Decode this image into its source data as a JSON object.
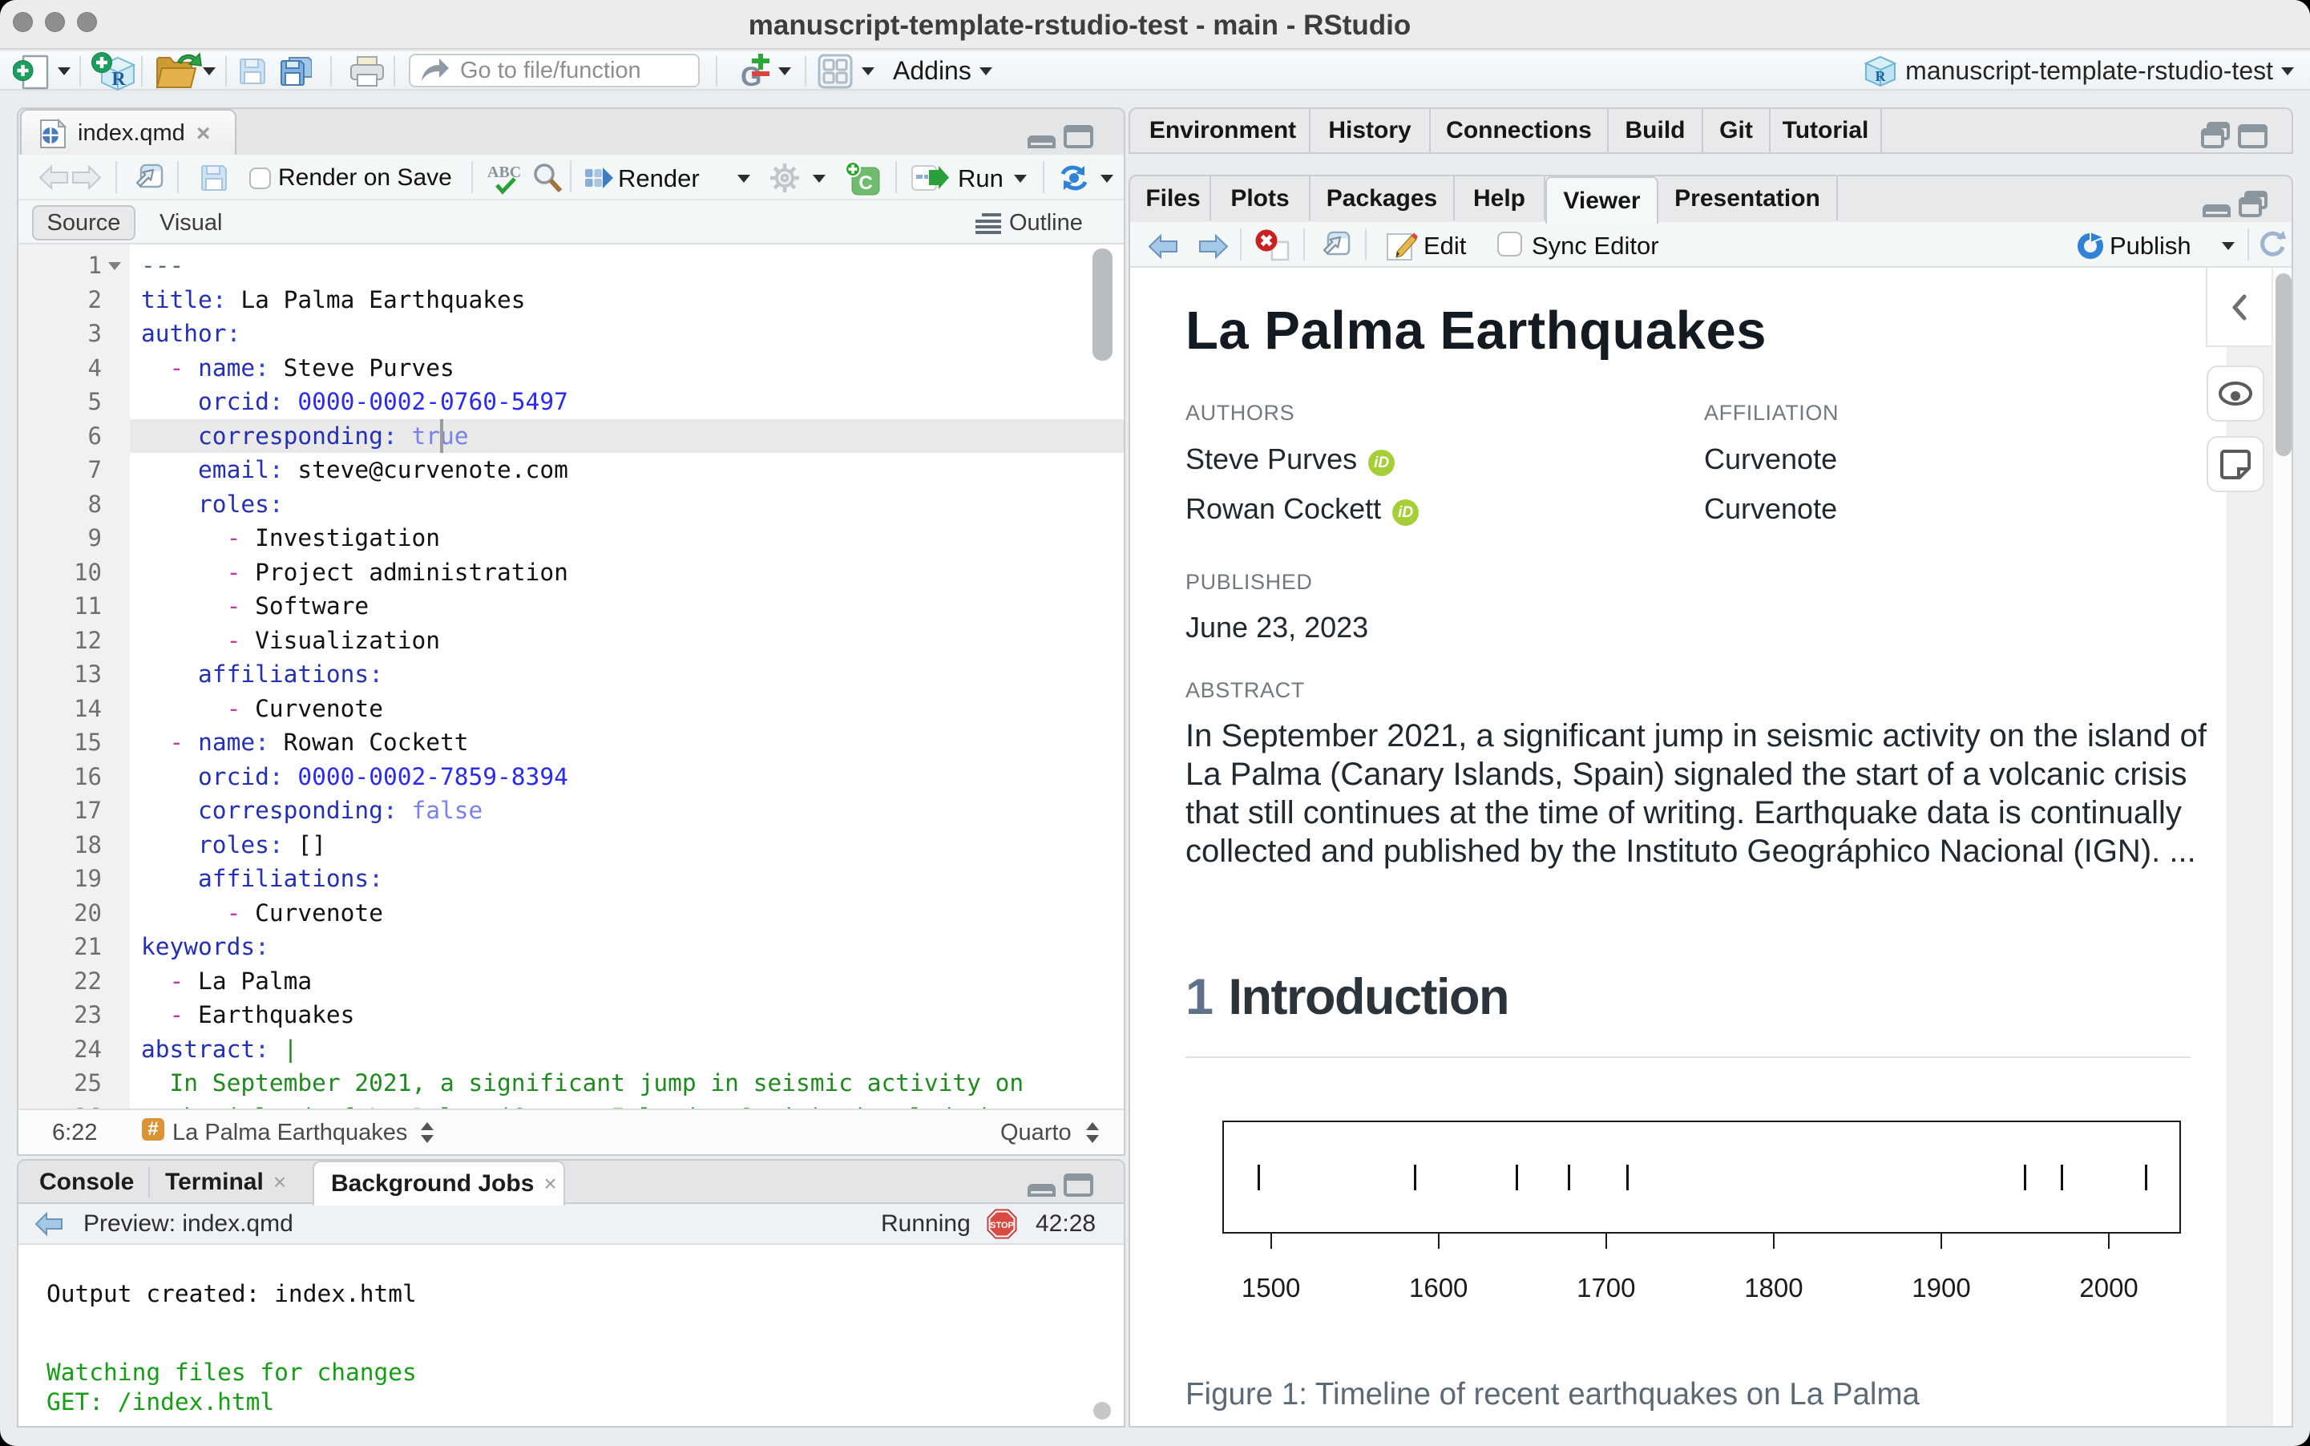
{
  "window": {
    "title": "manuscript-template-rstudio-test - main - RStudio",
    "project": "manuscript-template-rstudio-test"
  },
  "main_toolbar": {
    "goto_placeholder": "Go to file/function",
    "addins_label": "Addins"
  },
  "editor": {
    "tab": "index.qmd",
    "render_on_save": "Render on Save",
    "render_label": "Render",
    "run_label": "Run",
    "source_label": "Source",
    "visual_label": "Visual",
    "outline_label": "Outline",
    "cursor": {
      "line": 6,
      "col": 22
    },
    "lines": [
      [
        [
          "meta",
          "---"
        ]
      ],
      [
        [
          "key",
          "title"
        ],
        [
          "colon",
          ":"
        ],
        [
          "text",
          " La Palma Earthquakes"
        ]
      ],
      [
        [
          "key",
          "author"
        ],
        [
          "colon",
          ":"
        ]
      ],
      [
        [
          "text",
          "  "
        ],
        [
          "dash",
          "-"
        ],
        [
          "text",
          " "
        ],
        [
          "key",
          "name"
        ],
        [
          "colon",
          ":"
        ],
        [
          "text",
          " Steve Purves"
        ]
      ],
      [
        [
          "text",
          "    "
        ],
        [
          "key",
          "orcid"
        ],
        [
          "colon",
          ":"
        ],
        [
          "text",
          " "
        ],
        [
          "num",
          "0000-0002-0760-5497"
        ]
      ],
      [
        [
          "text",
          "    "
        ],
        [
          "key",
          "corresponding"
        ],
        [
          "colon",
          ":"
        ],
        [
          "text",
          " "
        ],
        [
          "bool",
          "true"
        ]
      ],
      [
        [
          "text",
          "    "
        ],
        [
          "key",
          "email"
        ],
        [
          "colon",
          ":"
        ],
        [
          "text",
          " steve@curvenote.com"
        ]
      ],
      [
        [
          "text",
          "    "
        ],
        [
          "key",
          "roles"
        ],
        [
          "colon",
          ":"
        ]
      ],
      [
        [
          "text",
          "      "
        ],
        [
          "dash",
          "-"
        ],
        [
          "text",
          " Investigation"
        ]
      ],
      [
        [
          "text",
          "      "
        ],
        [
          "dash",
          "-"
        ],
        [
          "text",
          " Project administration"
        ]
      ],
      [
        [
          "text",
          "      "
        ],
        [
          "dash",
          "-"
        ],
        [
          "text",
          " Software"
        ]
      ],
      [
        [
          "text",
          "      "
        ],
        [
          "dash",
          "-"
        ],
        [
          "text",
          " Visualization"
        ]
      ],
      [
        [
          "text",
          "    "
        ],
        [
          "key",
          "affiliations"
        ],
        [
          "colon",
          ":"
        ]
      ],
      [
        [
          "text",
          "      "
        ],
        [
          "dash",
          "-"
        ],
        [
          "text",
          " Curvenote"
        ]
      ],
      [
        [
          "text",
          "  "
        ],
        [
          "dash",
          "-"
        ],
        [
          "text",
          " "
        ],
        [
          "key",
          "name"
        ],
        [
          "colon",
          ":"
        ],
        [
          "text",
          " Rowan Cockett"
        ]
      ],
      [
        [
          "text",
          "    "
        ],
        [
          "key",
          "orcid"
        ],
        [
          "colon",
          ":"
        ],
        [
          "text",
          " "
        ],
        [
          "num",
          "0000-0002-7859-8394"
        ]
      ],
      [
        [
          "text",
          "    "
        ],
        [
          "key",
          "corresponding"
        ],
        [
          "colon",
          ":"
        ],
        [
          "text",
          " "
        ],
        [
          "bool",
          "false"
        ]
      ],
      [
        [
          "text",
          "    "
        ],
        [
          "key",
          "roles"
        ],
        [
          "colon",
          ":"
        ],
        [
          "text",
          " []"
        ]
      ],
      [
        [
          "text",
          "    "
        ],
        [
          "key",
          "affiliations"
        ],
        [
          "colon",
          ":"
        ]
      ],
      [
        [
          "text",
          "      "
        ],
        [
          "dash",
          "-"
        ],
        [
          "text",
          " Curvenote"
        ]
      ],
      [
        [
          "key",
          "keywords"
        ],
        [
          "colon",
          ":"
        ]
      ],
      [
        [
          "text",
          "  "
        ],
        [
          "dash",
          "-"
        ],
        [
          "text",
          " La Palma"
        ]
      ],
      [
        [
          "text",
          "  "
        ],
        [
          "dash",
          "-"
        ],
        [
          "text",
          " Earthquakes"
        ]
      ],
      [
        [
          "key",
          "abstract"
        ],
        [
          "colon",
          ":"
        ],
        [
          "text",
          " "
        ],
        [
          "green",
          "|"
        ]
      ],
      [
        [
          "green",
          "  In September 2021, a significant jump in seismic activity on"
        ]
      ],
      [
        [
          "green",
          "  the island of La Palma (Canary Islands, Spain) signaled the start"
        ]
      ]
    ],
    "status": {
      "position": "6:22",
      "section_icon": "#",
      "scope": "La Palma Earthquakes",
      "mode": "Quarto"
    }
  },
  "console": {
    "tabs": [
      "Console",
      "Terminal",
      "Background Jobs"
    ],
    "active_tab": "Background Jobs",
    "preview_label": "Preview: index.qmd",
    "running_label": "Running",
    "stop_label": "STOP",
    "elapsed": "42:28",
    "lines": [
      {
        "cls": "plain",
        "text": "Output created: index.html"
      },
      {
        "cls": "gap",
        "text": ""
      },
      {
        "cls": "green",
        "text": "Watching files for changes"
      },
      {
        "cls": "green",
        "text": "GET: /index.html"
      }
    ]
  },
  "env_pane": {
    "tabs": [
      "Environment",
      "History",
      "Connections",
      "Build",
      "Git",
      "Tutorial"
    ]
  },
  "files_pane": {
    "tabs": [
      "Files",
      "Plots",
      "Packages",
      "Help",
      "Viewer",
      "Presentation"
    ],
    "active_tab": "Viewer",
    "edit_label": "Edit",
    "sync_label": "Sync Editor",
    "publish_label": "Publish"
  },
  "viewer_doc": {
    "title": "La Palma Earthquakes",
    "authors_label": "AUTHORS",
    "orcid_label": "iD",
    "affiliation_label": "AFFILIATION",
    "authors": [
      {
        "name": "Steve Purves",
        "orcid_icon": "orcid-icon",
        "affiliation": "Curvenote"
      },
      {
        "name": "Rowan Cockett",
        "orcid_icon": "orcid-icon",
        "affiliation": "Curvenote"
      }
    ],
    "published_label": "PUBLISHED",
    "published": "June 23, 2023",
    "abstract_label": "ABSTRACT",
    "abstract_lines": [
      "In September 2021, a significant jump in seismic activity on the island of",
      "La Palma (Canary Islands, Spain) signaled the start of a volcanic crisis",
      "that still continues at the time of writing. Earthquake data is continually",
      "collected and published by the Instituto Geográphico Nacional (IGN). ..."
    ],
    "section_number": "1",
    "section_title": "Introduction"
  },
  "chart_data": {
    "type": "rug-timeline",
    "title": "Timeline of recent earthquakes on La Palma",
    "events": [
      1492,
      1585,
      1646,
      1677,
      1712,
      1949,
      1971,
      2021
    ],
    "xticks": [
      1500,
      1600,
      1700,
      1800,
      1900,
      2000
    ],
    "xlim": [
      1471,
      2043
    ],
    "xlabel": "",
    "ylabel": "",
    "caption": "Figure 1: Timeline of recent earthquakes on La Palma"
  }
}
